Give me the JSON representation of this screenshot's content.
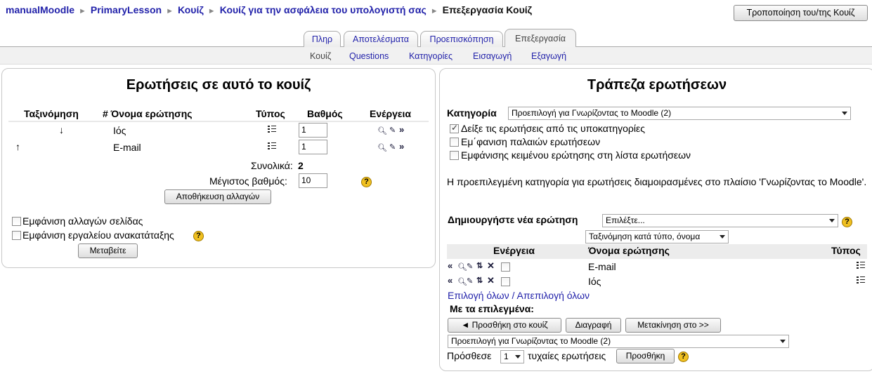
{
  "breadcrumb": {
    "items": [
      "manualMoodle",
      "PrimaryLesson",
      "Κουίζ",
      "Κουίζ για την ασφάλεια του υπολογιστή σας"
    ],
    "current": "Επεξεργασία Κουίζ",
    "separator": "►"
  },
  "header": {
    "edit_button": "Τροποποίηση του/της Κουίζ"
  },
  "tabs": [
    "Πληρ",
    "Αποτελέσματα",
    "Προεπισκόπηση",
    "Επεξεργασία"
  ],
  "subtabs": [
    "Κουίζ",
    "Questions",
    "Κατηγορίες",
    "Εισαγωγή",
    "Εξαγωγή"
  ],
  "quiz_panel": {
    "title": "Ερωτήσεις σε αυτό το κουίζ",
    "columns": {
      "order": "Ταξινόμηση",
      "name": "# Όνομα ερώτησης",
      "type": "Τύπος",
      "grade": "Βαθμός",
      "action": "Ενέργεια"
    },
    "rows": [
      {
        "name": "Ιός",
        "grade": "1"
      },
      {
        "name": "E-mail",
        "grade": "1"
      }
    ],
    "total_label": "Συνολικά:",
    "total_value": "2",
    "max_grade_label": "Μέγιστος βαθμός:",
    "max_grade_value": "10",
    "save_button": "Αποθήκευση αλλαγών",
    "show_page_breaks": "Εμφάνιση αλλαγών σελίδας",
    "show_reorder_tool": "Εμφάνιση εργαλείου ανακατάταξης",
    "go_button": "Μεταβείτε"
  },
  "bank_panel": {
    "title": "Τράπεζα ερωτήσεων",
    "category_label": "Κατηγορία",
    "category_value": "Προεπιλογή για Γνωρίζοντας το Moodle (2)",
    "options": [
      {
        "label": "Δείξε τις ερωτήσεις από τις υποκατηγορίες",
        "checked": true
      },
      {
        "label": "Εμ΄φανιση παλαιών ερωτήσεων",
        "checked": false
      },
      {
        "label": "Εμφάνισης κειμένου ερώτησης στη λίστα ερωτήσεων",
        "checked": false
      }
    ],
    "info_text": "Η προεπιλεγμένη κατηγορία για ερωτήσεις διαμοιρασμένες στο πλαίσιο 'Γνωρίζοντας το Moodle'.",
    "create_label": "Δημιουργήστε νέα ερώτηση",
    "create_select": "Επιλέξτε...",
    "sort_select": "Ταξινόμηση κατά τύπο, όνομα",
    "columns": {
      "action": "Ενέργεια",
      "name": "Όνομα ερώτησης",
      "type": "Τύπος"
    },
    "rows": [
      {
        "name": "E-mail"
      },
      {
        "name": "Ιός"
      }
    ],
    "select_all": "Επιλογή όλων",
    "select_sep": "/",
    "deselect_all": "Απεπιλογή όλων",
    "with_selected": "Με τα επιλεγμένα:",
    "add_to_quiz_button": "◄ Προσθήκη στο κουίζ",
    "delete_button": "Διαγραφή",
    "move_button": "Μετακίνηση στο >>",
    "move_target": "Προεπιλογή για Γνωρίζοντας το Moodle (2)",
    "random_prefix": "Πρόσθεσε",
    "random_count": "1",
    "random_suffix": "τυχαίες ερωτήσεις",
    "random_add_button": "Προσθήκη"
  }
}
